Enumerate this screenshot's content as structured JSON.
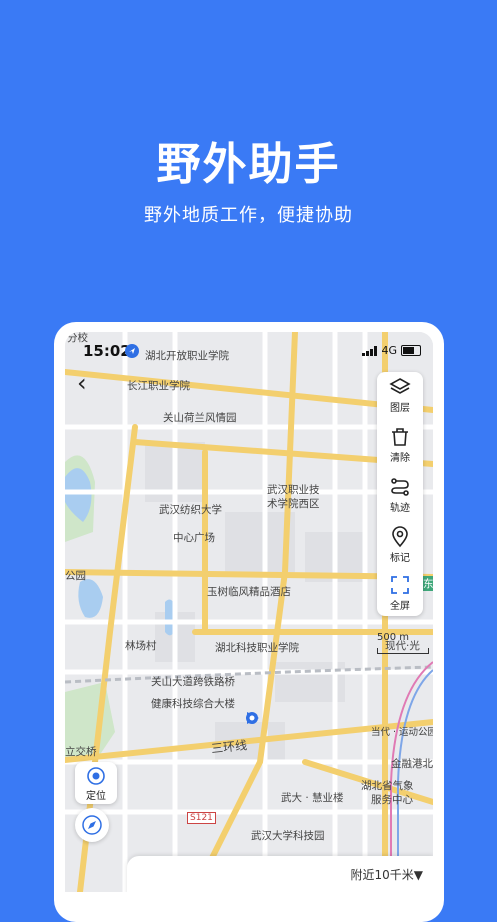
{
  "promo": {
    "title": "野外助手",
    "subtitle": "野外地质工作，便捷协助"
  },
  "status_bar": {
    "time": "15:02",
    "network": "4G"
  },
  "map": {
    "labels": {
      "hubei_open": "湖北开放职业学院",
      "changjiang": "长江职业学院",
      "guanshan": "关山荷兰风情园",
      "wuhan_tech": "武汉职业技",
      "wuhan_tech2": "术学院西区",
      "wuhan_textile": "武汉纺织大学",
      "zhongxin": "中心广场",
      "yushu": "玉树临风精品酒店",
      "linchang": "林场村",
      "hubei_keji": "湖北科技职业学院",
      "guanshan_bridge": "关山大道跨铁路桥",
      "jiankang": "健康科技综合大楼",
      "sanhuan": "三环线",
      "huiyu": "武大 · 慧业楼",
      "qixiang1": "湖北省气象",
      "qixiang2": "服务中心",
      "keji_park": "武汉大学科技园",
      "jinrong": "金融港北",
      "park": "公园",
      "jiaoqiao": "立交桥",
      "s121": "S121",
      "dangdai": "当代 · 运动公园",
      "dongxing": "东",
      "xiandai": "现代·光",
      "fenxiao": "分校"
    }
  },
  "toolbar": {
    "layers": "图层",
    "clear": "清除",
    "track": "轨迹",
    "mark": "标记",
    "fullscreen": "全屏"
  },
  "scale": "500 m",
  "locate": "定位",
  "nearby": "附近10千米▼",
  "colors": {
    "background": "#3a7af5",
    "road_major": "#f3cf6e",
    "location": "#2f6fe4"
  }
}
